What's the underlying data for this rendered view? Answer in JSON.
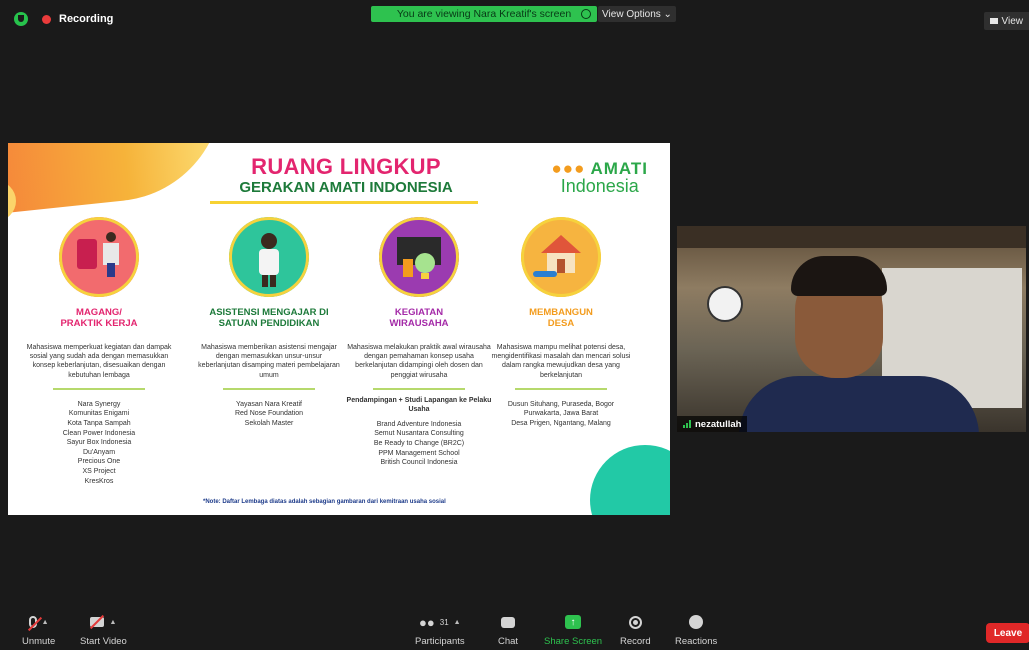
{
  "recording": {
    "label": "Recording"
  },
  "share_banner": {
    "text": "You are viewing Nara Kreatif's screen"
  },
  "view_options": {
    "label": "View Options ⌄"
  },
  "view_button": {
    "label": "View"
  },
  "slide": {
    "title": "RUANG LINGKUP",
    "subtitle": "GERAKAN AMATI INDONESIA",
    "logo_top": "AMATI",
    "logo_bottom": "Indonesia",
    "columns": [
      {
        "heading_1": "MAGANG/",
        "heading_2": "PRAKTIK KERJA",
        "color": "#e3256f",
        "circle_color": "#f26b6e",
        "description": "Mahasiswa memperkuat kegiatan dan dampak sosial yang sudah ada dengan memasukkan konsep keberlanjutan, disesuaikan dengan kebutuhan lembaga",
        "subheading": "",
        "list": [
          "Nara Synergy",
          "Komunitas Enigami",
          "Kota Tanpa Sampah",
          "Clean Power Indonesia",
          "Sayur Box Indonesia",
          "Du'Anyam",
          "Precious One",
          "XS Project",
          "KresKros"
        ]
      },
      {
        "heading_1": "ASISTENSI MENGAJAR DI",
        "heading_2": "SATUAN PENDIDIKAN",
        "color": "#1d7a3a",
        "circle_color": "#2ec59b",
        "description": "Mahasiswa memberikan asistensi mengajar dengan memasukkan unsur-unsur keberlanjutan disamping materi pembelajaran umum",
        "subheading": "",
        "list": [
          "Yayasan Nara Kreatif",
          "Red Nose Foundation",
          "Sekolah Master"
        ]
      },
      {
        "heading_1": "KEGIATAN",
        "heading_2": "WIRAUSAHA",
        "color": "#a42aa8",
        "circle_color": "#9b3bb0",
        "description": "Mahasiswa melakukan praktik awal wirausaha dengan pemahaman konsep usaha berkelanjutan didampingi oleh dosen dan penggiat wirusaha",
        "subheading": "Pendampingan + Studi Lapangan ke Pelaku Usaha",
        "list": [
          "Brand Adventure Indonesia",
          "Semut Nusantara Consulting",
          "Be Ready to Change (BR2C)",
          "PPM Management School",
          "British Council Indonesia"
        ]
      },
      {
        "heading_1": "MEMBANGUN",
        "heading_2": "DESA",
        "color": "#f39c1e",
        "circle_color": "#f6b440",
        "description": "Mahasiswa mampu melihat potensi desa, mengidentifikasi masalah dan mencari solusi dalam rangka mewujudkan desa yang berkelanjutan",
        "subheading": "",
        "list": [
          "Dusun Situhang, Puraseda, Bogor",
          "Purwakarta, Jawa Barat",
          "Desa Prigen, Ngantang, Malang"
        ]
      }
    ],
    "note": "*Note: Daftar Lembaga diatas adalah sebagian gambaran dari kemitraan usaha sosial"
  },
  "participant": {
    "name": "nezatullah"
  },
  "toolbar": {
    "unmute": "Unmute",
    "start_video": "Start Video",
    "participants": "Participants",
    "participants_count": "31",
    "chat": "Chat",
    "share_screen": "Share Screen",
    "record": "Record",
    "reactions": "Reactions",
    "leave": "Leave"
  }
}
